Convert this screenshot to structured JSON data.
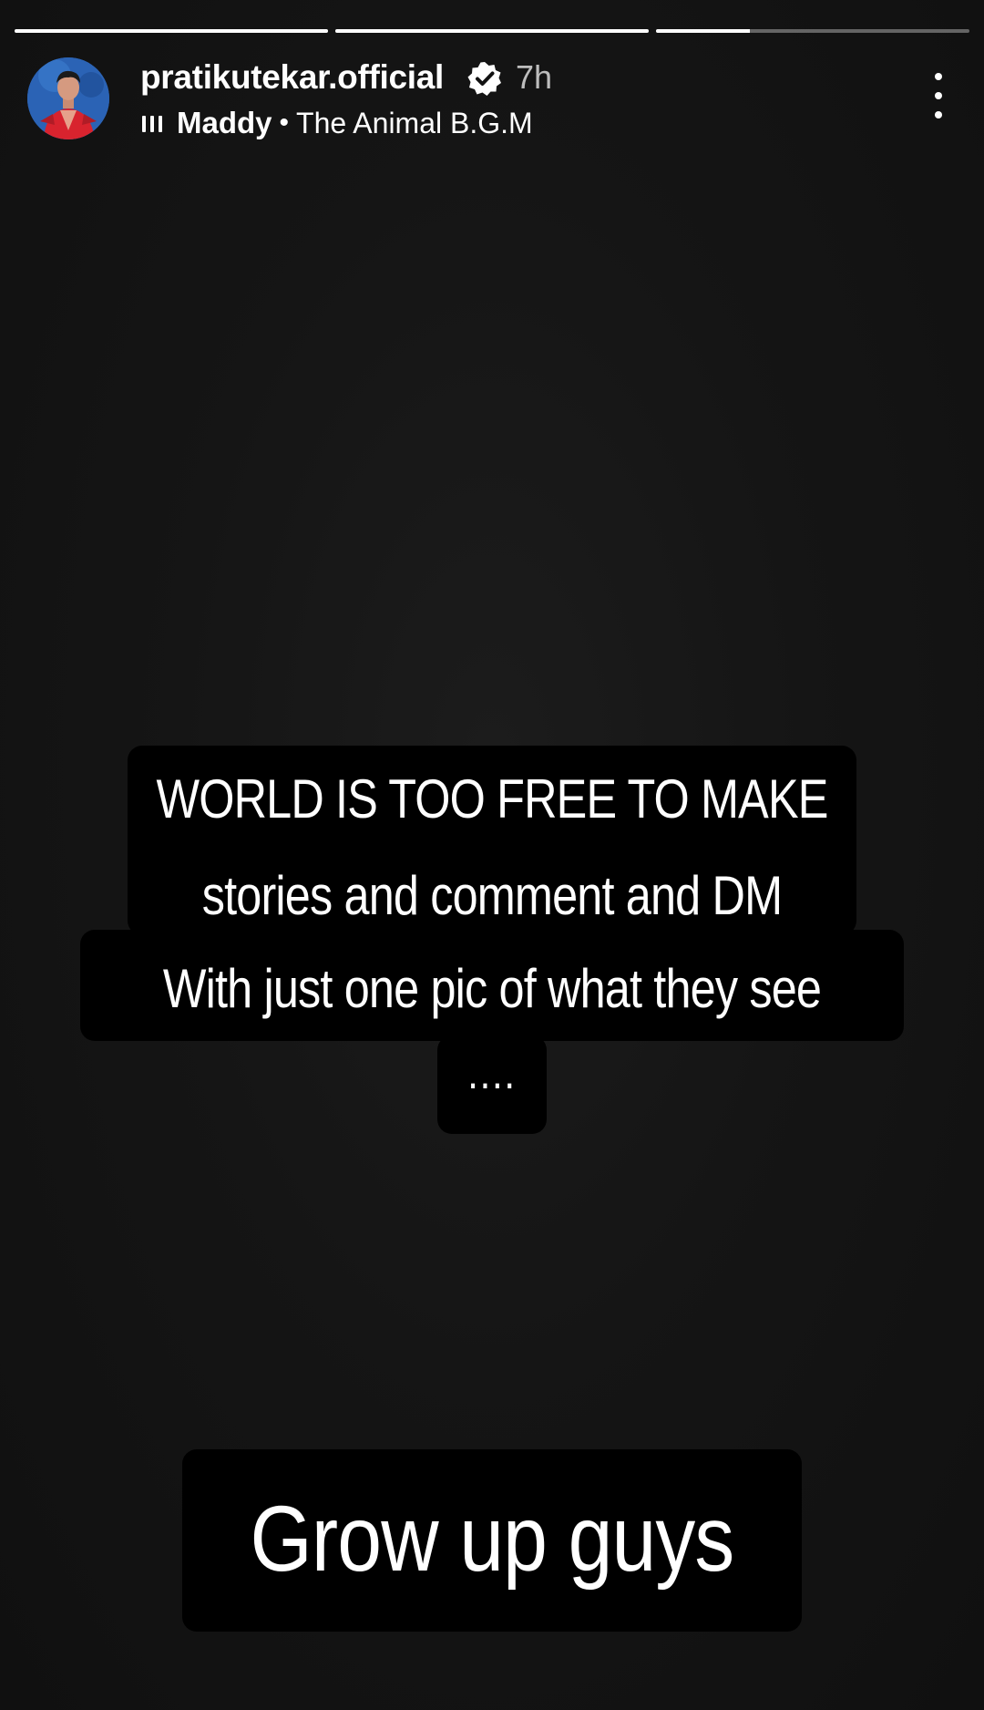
{
  "story": {
    "progress_segments": [
      {
        "label": "segment-1",
        "fill": 1.0
      },
      {
        "label": "segment-2",
        "fill": 1.0
      },
      {
        "label": "segment-3",
        "fill": 0.3
      }
    ],
    "header": {
      "username": "pratikutekar.official",
      "verified_icon": "verified-badge-icon",
      "time_ago": "7h",
      "music": {
        "artist": "Maddy",
        "separator": "•",
        "track": "The Animal B.G.M"
      },
      "more_icon": "more-vertical-icon"
    },
    "text_overlays": {
      "line1": "WORLD IS TOO FREE TO MAKE",
      "line2": "stories and comment and DM",
      "line3": "With just one pic of what they see",
      "line4": "....",
      "closing": "Grow up guys"
    }
  },
  "colors": {
    "background": "#111111",
    "text": "#ffffff",
    "text_block": "#000000",
    "progress_track": "#ffffff59",
    "time": "#ffffffb8"
  }
}
